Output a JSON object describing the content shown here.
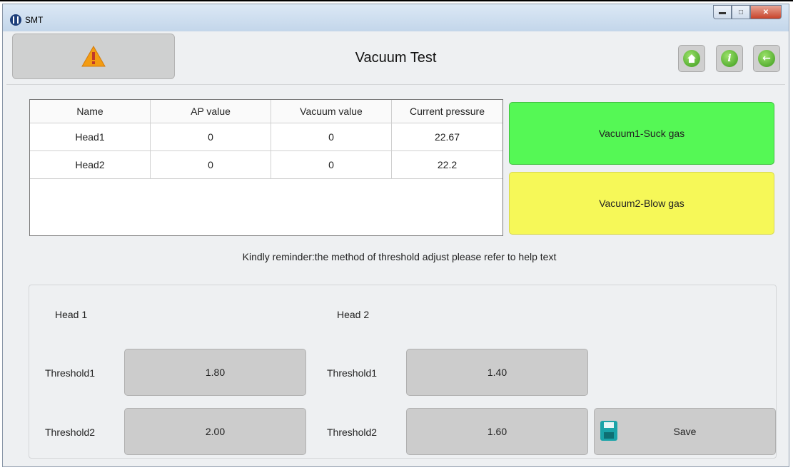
{
  "window": {
    "title": "SMT"
  },
  "header": {
    "title": "Vacuum Test"
  },
  "table": {
    "headers": [
      "Name",
      "AP value",
      "Vacuum value",
      "Current pressure"
    ],
    "rows": [
      [
        "Head1",
        "0",
        "0",
        "22.67"
      ],
      [
        "Head2",
        "0",
        "0",
        "22.2"
      ]
    ]
  },
  "buttons": {
    "vacuum1": "Vacuum1-Suck gas",
    "vacuum2": "Vacuum2-Blow gas",
    "save": "Save"
  },
  "reminder": "Kindly reminder:the method of threshold adjust please refer to help text",
  "thresholds": {
    "head1": {
      "label": "Head 1",
      "t1_label": "Threshold1",
      "t1": "1.80",
      "t2_label": "Threshold2",
      "t2": "2.00"
    },
    "head2": {
      "label": "Head 2",
      "t1_label": "Threshold1",
      "t1": "1.40",
      "t2_label": "Threshold2",
      "t2": "1.60"
    }
  },
  "colors": {
    "vacuum1": "#55f855",
    "vacuum2": "#f6f858",
    "button_gray": "#cccccc"
  },
  "icons": [
    "warning-icon",
    "home-icon",
    "info-icon",
    "back-arrow-icon",
    "floppy-disk-icon"
  ]
}
